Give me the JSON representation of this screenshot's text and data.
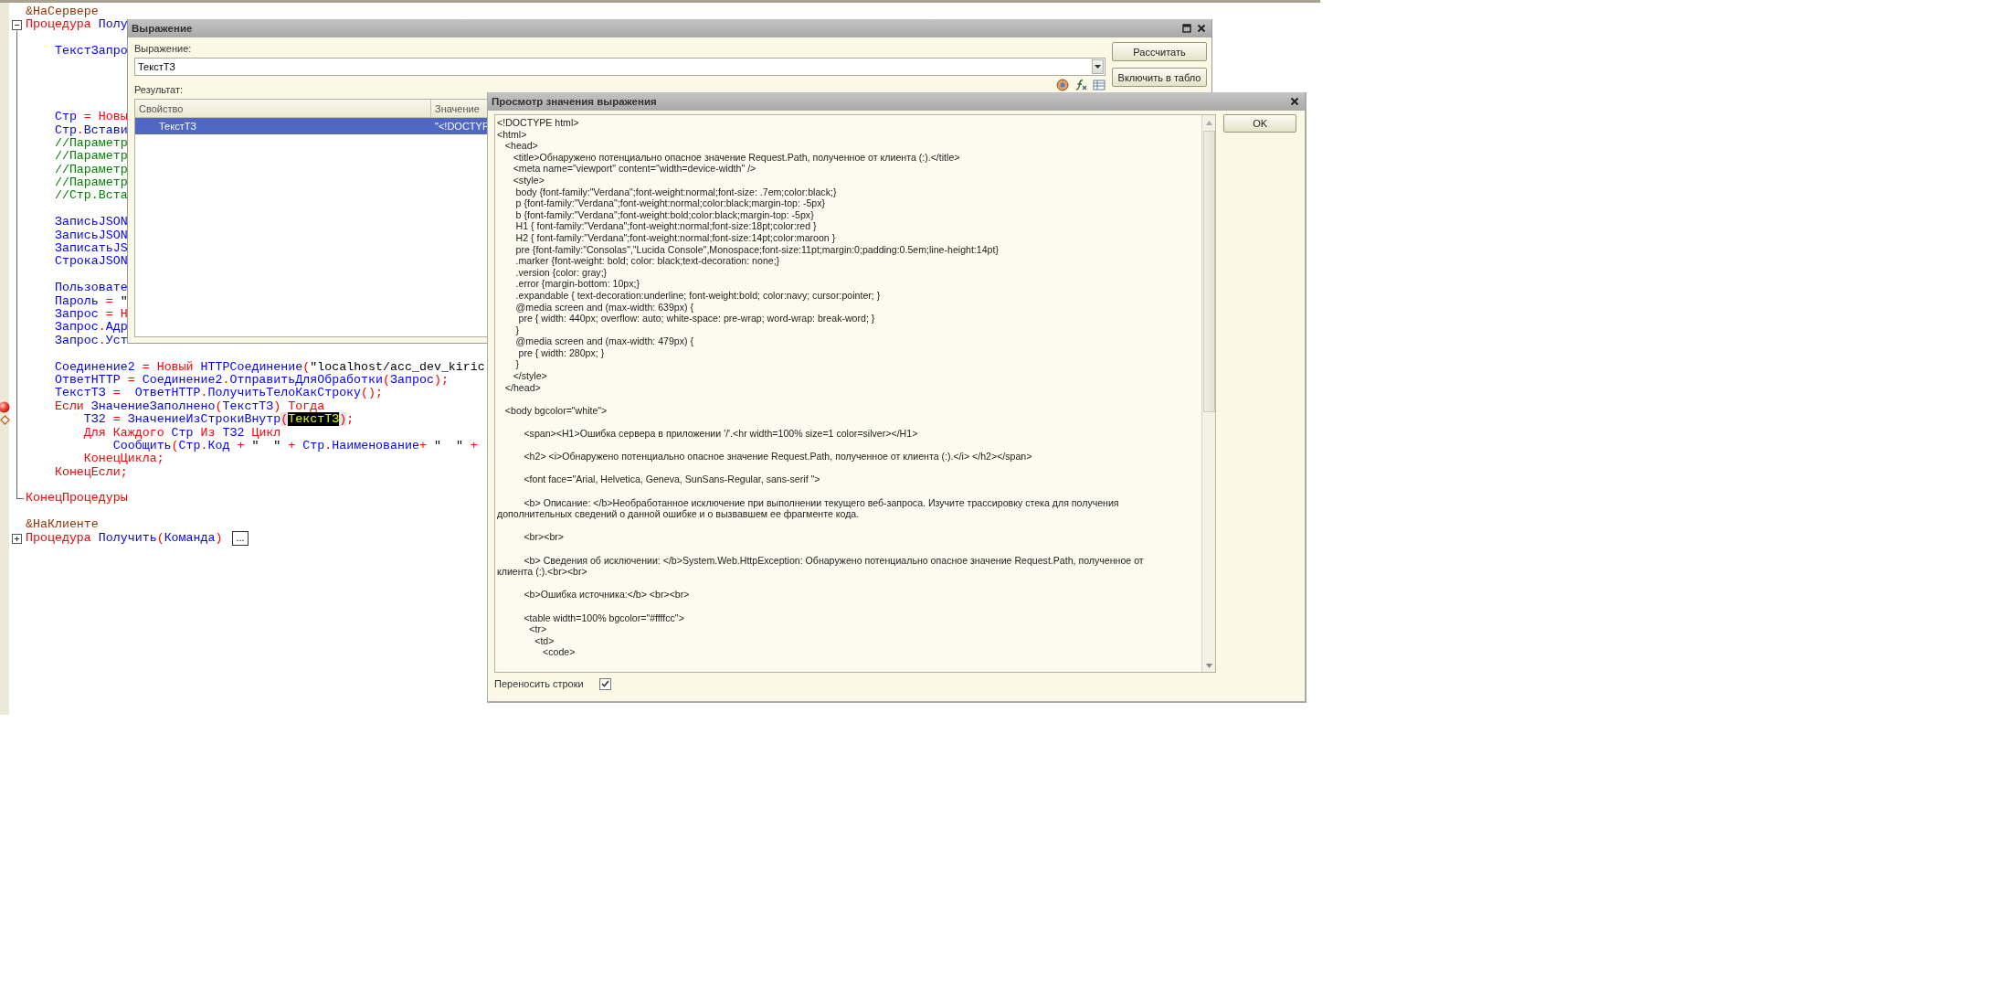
{
  "code_editor": {
    "lines": [
      {
        "kind": "code",
        "tokens": [
          {
            "text": "&НаСервере",
            "kind": "directive"
          }
        ]
      },
      {
        "kind": "code",
        "expanded": true,
        "tokens": [
          {
            "text": "Процедура ",
            "kind": "keyword"
          },
          {
            "text": "Полу",
            "kind": "identifier"
          }
        ],
        "children": [
          {
            "kind": "blank"
          },
          {
            "kind": "code",
            "tokens": [
              {
                "text": "    ТекстЗапро",
                "kind": "identifier"
              }
            ]
          },
          {
            "kind": "blank"
          },
          {
            "kind": "blank"
          },
          {
            "kind": "blank"
          },
          {
            "kind": "blank"
          },
          {
            "kind": "code",
            "tokens": [
              {
                "text": "    Стр",
                "kind": "identifier"
              },
              {
                "text": " = ",
                "kind": "operator"
              },
              {
                "text": "Новы",
                "kind": "keyword"
              }
            ]
          },
          {
            "kind": "code",
            "tokens": [
              {
                "text": "    Стр",
                "kind": "identifier"
              },
              {
                "text": ".",
                "kind": "operator"
              },
              {
                "text": "Встави",
                "kind": "identifier"
              }
            ]
          },
          {
            "kind": "code",
            "tokens": [
              {
                "text": "    //Параметр",
                "kind": "comment"
              }
            ]
          },
          {
            "kind": "code",
            "tokens": [
              {
                "text": "    //Параметр",
                "kind": "comment"
              }
            ]
          },
          {
            "kind": "code",
            "tokens": [
              {
                "text": "    //Параметр",
                "kind": "comment"
              }
            ]
          },
          {
            "kind": "code",
            "tokens": [
              {
                "text": "    //Параметр",
                "kind": "comment"
              }
            ]
          },
          {
            "kind": "code",
            "tokens": [
              {
                "text": "    //Стр.Вста",
                "kind": "comment"
              }
            ]
          },
          {
            "kind": "blank"
          },
          {
            "kind": "code",
            "tokens": [
              {
                "text": "    ЗаписьJSON",
                "kind": "identifier"
              }
            ]
          },
          {
            "kind": "code",
            "tokens": [
              {
                "text": "    ЗаписьJSON",
                "kind": "identifier"
              }
            ]
          },
          {
            "kind": "code",
            "tokens": [
              {
                "text": "    ЗаписатьJS",
                "kind": "identifier"
              }
            ]
          },
          {
            "kind": "code",
            "tokens": [
              {
                "text": "    СтрокаJSON",
                "kind": "identifier"
              }
            ]
          },
          {
            "kind": "blank"
          },
          {
            "kind": "code",
            "tokens": [
              {
                "text": "    Пользовате",
                "kind": "identifier"
              }
            ]
          },
          {
            "kind": "code",
            "tokens": [
              {
                "text": "    Пароль",
                "kind": "identifier"
              },
              {
                "text": " = ",
                "kind": "operator"
              },
              {
                "text": "\"",
                "kind": "string"
              }
            ]
          },
          {
            "kind": "code",
            "tokens": [
              {
                "text": "    Запрос",
                "kind": "identifier"
              },
              {
                "text": " = ",
                "kind": "operator"
              },
              {
                "text": "Н",
                "kind": "keyword"
              }
            ]
          },
          {
            "kind": "code",
            "tokens": [
              {
                "text": "    Запрос",
                "kind": "identifier"
              },
              {
                "text": ".",
                "kind": "operator"
              },
              {
                "text": "Адр",
                "kind": "identifier"
              }
            ]
          },
          {
            "kind": "code",
            "tokens": [
              {
                "text": "    Запрос",
                "kind": "identifier"
              },
              {
                "text": ".",
                "kind": "operator"
              },
              {
                "text": "Уст",
                "kind": "identifier"
              }
            ]
          },
          {
            "kind": "blank"
          },
          {
            "kind": "code",
            "tokens": [
              {
                "text": "    Соединение2",
                "kind": "identifier"
              },
              {
                "text": " = ",
                "kind": "operator"
              },
              {
                "text": "Новый",
                "kind": "keyword"
              },
              {
                "text": " HTTPСоединение",
                "kind": "identifier"
              },
              {
                "text": "(",
                "kind": "operator"
              },
              {
                "text": "\"localhost/acc_dev_kiric",
                "kind": "string"
              }
            ]
          },
          {
            "kind": "code",
            "tokens": [
              {
                "text": "    ОтветHTTP",
                "kind": "identifier"
              },
              {
                "text": " = ",
                "kind": "operator"
              },
              {
                "text": "Соединение2",
                "kind": "identifier"
              },
              {
                "text": ".",
                "kind": "operator"
              },
              {
                "text": "ОтправитьДляОбработки",
                "kind": "identifier"
              },
              {
                "text": "(",
                "kind": "operator"
              },
              {
                "text": "Запрос",
                "kind": "identifier"
              },
              {
                "text": ");",
                "kind": "operator"
              }
            ]
          },
          {
            "kind": "code",
            "tokens": [
              {
                "text": "    ТекстТЗ",
                "kind": "identifier"
              },
              {
                "text": " =  ",
                "kind": "operator"
              },
              {
                "text": "ОтветHTTP",
                "kind": "identifier"
              },
              {
                "text": ".",
                "kind": "operator"
              },
              {
                "text": "ПолучитьТелоКакСтроку",
                "kind": "identifier"
              },
              {
                "text": "();",
                "kind": "operator"
              }
            ]
          },
          {
            "kind": "code",
            "breakpoint": true,
            "tokens": [
              {
                "text": "    Если ",
                "kind": "keyword"
              },
              {
                "text": "ЗначениеЗаполнено",
                "kind": "identifier"
              },
              {
                "text": "(",
                "kind": "operator"
              },
              {
                "text": "ТекстТЗ",
                "kind": "identifier"
              },
              {
                "text": ")",
                "kind": "operator"
              },
              {
                "text": " Тогда",
                "kind": "keyword"
              }
            ]
          },
          {
            "kind": "code",
            "current": true,
            "tokens": [
              {
                "text": "        ТЗ2",
                "kind": "identifier"
              },
              {
                "text": " = ",
                "kind": "operator"
              },
              {
                "text": "ЗначениеИзСтрокиВнутр",
                "kind": "identifier"
              },
              {
                "text": "(",
                "kind": "bracket"
              },
              {
                "text": "ТекстТЗ",
                "kind": "match"
              },
              {
                "text": ")",
                "kind": "bracket"
              },
              {
                "text": ";",
                "kind": "operator"
              }
            ]
          },
          {
            "kind": "code",
            "tokens": [
              {
                "text": "        Для Каждого ",
                "kind": "keyword"
              },
              {
                "text": "Стр",
                "kind": "identifier"
              },
              {
                "text": " Из ",
                "kind": "keyword"
              },
              {
                "text": "ТЗ2",
                "kind": "identifier"
              },
              {
                "text": " Цикл",
                "kind": "keyword"
              }
            ]
          },
          {
            "kind": "code",
            "tokens": [
              {
                "text": "            Сообщить",
                "kind": "identifier"
              },
              {
                "text": "(",
                "kind": "operator"
              },
              {
                "text": "Стр",
                "kind": "identifier"
              },
              {
                "text": ".",
                "kind": "operator"
              },
              {
                "text": "Код",
                "kind": "identifier"
              },
              {
                "text": " + ",
                "kind": "operator"
              },
              {
                "text": "\"  \"",
                "kind": "string"
              },
              {
                "text": " + ",
                "kind": "operator"
              },
              {
                "text": "Стр",
                "kind": "identifier"
              },
              {
                "text": ".",
                "kind": "operator"
              },
              {
                "text": "Наименование",
                "kind": "identifier"
              },
              {
                "text": "+ ",
                "kind": "operator"
              },
              {
                "text": "\"  \"",
                "kind": "string"
              },
              {
                "text": " +",
                "kind": "operator"
              }
            ]
          },
          {
            "kind": "code",
            "tokens": [
              {
                "text": "        КонецЦикла;",
                "kind": "keyword"
              }
            ]
          },
          {
            "kind": "code",
            "tokens": [
              {
                "text": "    КонецЕсли;",
                "kind": "keyword"
              }
            ]
          },
          {
            "kind": "blank"
          },
          {
            "kind": "code",
            "tokens": [
              {
                "text": "КонецПроцедуры",
                "kind": "keyword"
              }
            ]
          }
        ]
      },
      {
        "kind": "blank"
      },
      {
        "kind": "code",
        "tokens": [
          {
            "text": "&НаКлиенте",
            "kind": "directive"
          }
        ]
      },
      {
        "kind": "code",
        "expanded": false,
        "collapsed_label": "...",
        "tokens": [
          {
            "text": "Процедура ",
            "kind": "keyword"
          },
          {
            "text": "Получить",
            "kind": "identifier"
          },
          {
            "text": "(",
            "kind": "operator"
          },
          {
            "text": "Команда",
            "kind": "identifier"
          },
          {
            "text": ")",
            "kind": "operator"
          }
        ]
      }
    ]
  },
  "expression_dialog": {
    "title": "Выражение",
    "expression_label": "Выражение:",
    "expression_value": "ТекстТЗ",
    "buttons": [
      "Рассчитать",
      "Включить в табло"
    ],
    "result_label": "Результат:",
    "table": {
      "columns": [
        "Свойство",
        "Значение"
      ],
      "rows": [
        {
          "property": "ТекстТЗ",
          "value": "\"<!DOCTYP",
          "selected": true
        }
      ]
    }
  },
  "preview_dialog": {
    "title": "Просмотр значения выражения",
    "ok_button": "OK",
    "wrap_lines": {
      "label": "Переносить строки",
      "checked": true
    },
    "blocks": [
      [
        "<!DOCTYPE html>",
        "<html>",
        "   <head>",
        "      <title>Обнаружено потенциально опасное значение Request.Path, полученное от клиента (:).</title>",
        "      <meta name=\"viewport\" content=\"width=device-width\" />",
        "      <style>",
        "       body {font-family:\"Verdana\";font-weight:normal;font-size: .7em;color:black;}",
        "       p {font-family:\"Verdana\";font-weight:normal;color:black;margin-top: -5px}",
        "       b {font-family:\"Verdana\";font-weight:bold;color:black;margin-top: -5px}",
        "       H1 { font-family:\"Verdana\";font-weight:normal;font-size:18pt;color:red }",
        "       H2 { font-family:\"Verdana\";font-weight:normal;font-size:14pt;color:maroon }",
        "       pre {font-family:\"Consolas\",\"Lucida Console\",Monospace;font-size:11pt;margin:0;padding:0.5em;line-height:14pt}",
        "       .marker {font-weight: bold; color: black;text-decoration: none;}",
        "       .version {color: gray;}",
        "       .error {margin-bottom: 10px;}",
        "       .expandable { text-decoration:underline; font-weight:bold; color:navy; cursor:pointer; }",
        "       @media screen and (max-width: 639px) {",
        "        pre { width: 440px; overflow: auto; white-space: pre-wrap; word-wrap: break-word; }",
        "       }",
        "       @media screen and (max-width: 479px) {",
        "        pre { width: 280px; }",
        "       }",
        "      </style>",
        "   </head>"
      ],
      [
        "   <body bgcolor=\"white\">"
      ],
      [
        "          <span><H1>Ошибка сервера в приложении '/'.<hr width=100% size=1 color=silver></H1>"
      ],
      [
        "          <h2> <i>Обнаружено потенциально опасное значение Request.Path, полученное от клиента (:).</i> </h2></span>"
      ],
      [
        "          <font face=\"Arial, Helvetica, Geneva, SunSans-Regular, sans-serif \">"
      ],
      [
        "          <b> Описание: </b>Необработанное исключение при выполнении текущего веб-запроса. Изучите трассировку стека для получения",
        "дополнительных сведений о данной ошибке и о вызвавшем ее фрагменте кода."
      ],
      [
        "          <br><br>"
      ],
      [
        "          <b> Сведения об исключении: </b>System.Web.HttpException: Обнаружено потенциально опасное значение Request.Path, полученное от",
        "клиента (:).<br><br>"
      ],
      [
        "          <b>Ошибка источника:</b> <br><br>"
      ],
      [
        "          <table width=100% bgcolor=\"#ffffcc\">",
        "            <tr>",
        "              <td>",
        "                 <code>"
      ]
    ]
  }
}
